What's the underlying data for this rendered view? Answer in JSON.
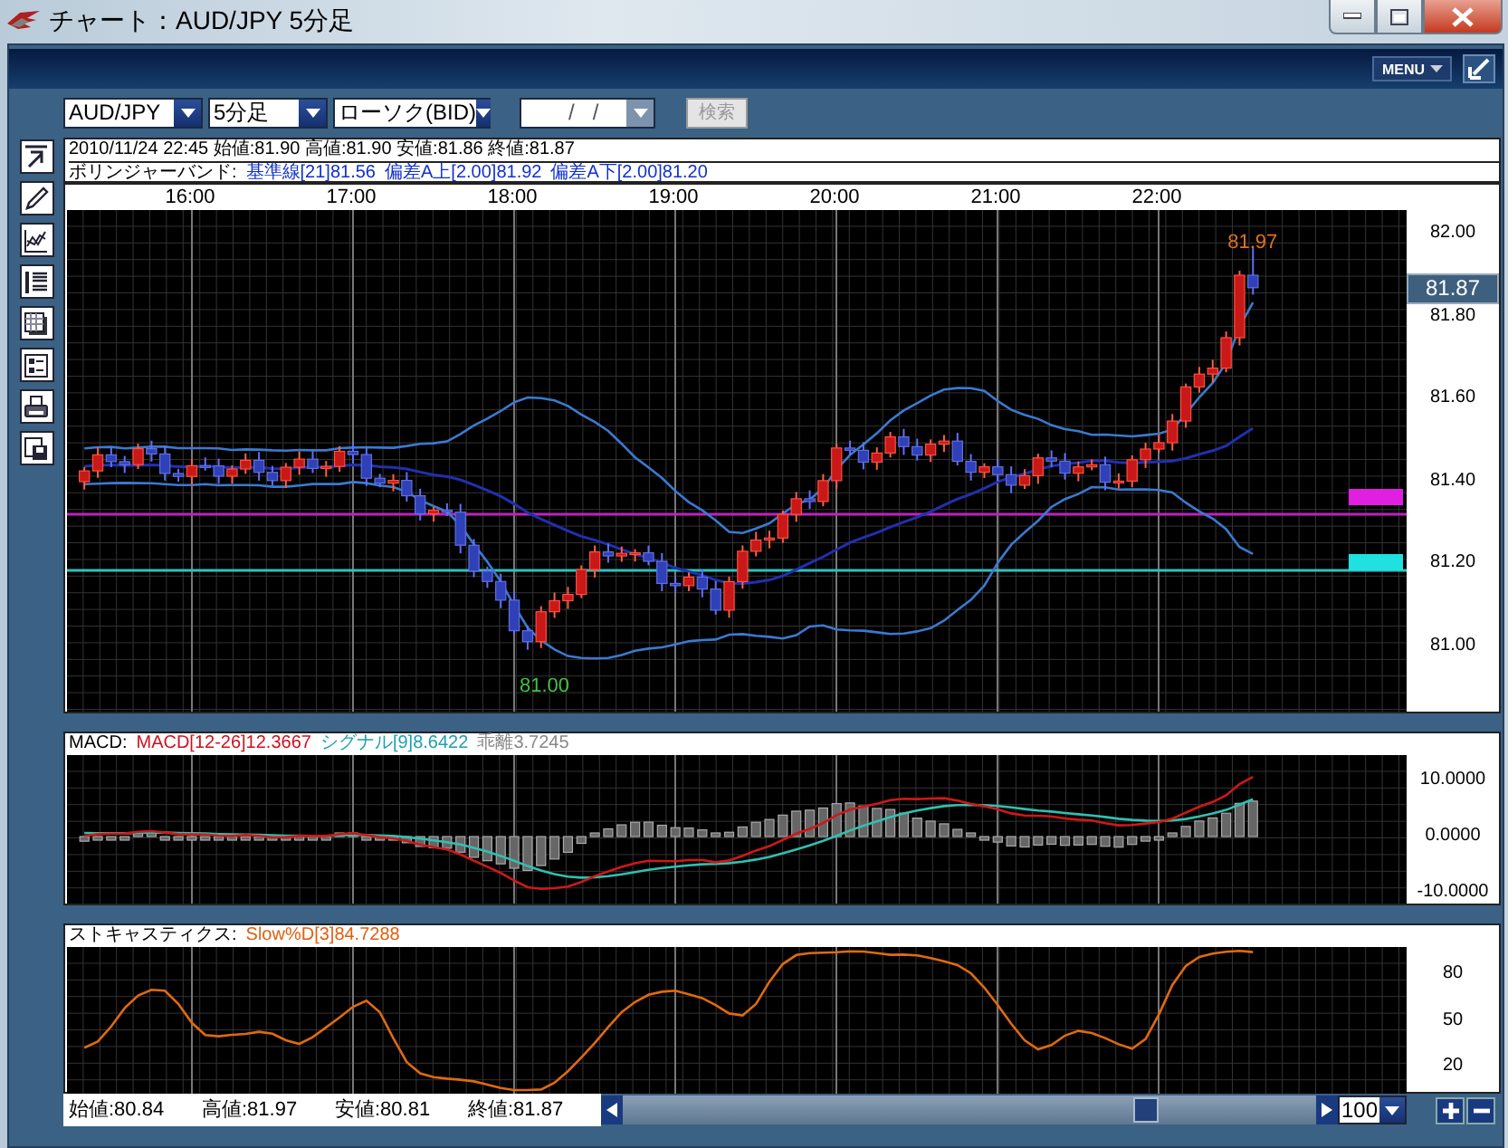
{
  "window": {
    "title": "チャート：AUD/JPY 5分足"
  },
  "header": {
    "menu_button": "MENU"
  },
  "toolbar": {
    "pair": "AUD/JPY",
    "timeframe": "5分足",
    "chart_type": "ローソク(BID)",
    "date_field": {
      "value": "/   /",
      "disabled": true
    },
    "search_button": {
      "label": "検索",
      "disabled": true
    }
  },
  "info": {
    "ohlc": "2010/11/24 22:45 始値:81.90 高値:81.90 安値:81.86 終値:81.87",
    "bollinger_label": "ボリンジャーバンド:",
    "bollinger_values": [
      "基準線[21]81.56",
      "偏差A上[2.00]81.92",
      "偏差A下[2.00]81.20"
    ]
  },
  "price_chart": {
    "time_labels": [
      "16:00",
      "17:00",
      "18:00",
      "19:00",
      "20:00",
      "21:00",
      "22:00"
    ],
    "price_labels": [
      "82.00",
      "81.80",
      "81.60",
      "81.40",
      "81.20",
      "81.00"
    ],
    "current_price": "81.87",
    "high_label": "81.97",
    "low_label": "81.00"
  },
  "macd": {
    "title": "MACD:",
    "macd": "MACD[12-26]12.3667",
    "signal": "シグナル[9]8.6422",
    "divergence": "乖離3.7245",
    "axis_labels": [
      "10.0000",
      "0.0000",
      "-10.0000"
    ]
  },
  "stochastic": {
    "title": "ストキャスティクス:",
    "slow_d": "Slow%D[3]84.7288",
    "axis_labels": [
      "80",
      "50",
      "20"
    ]
  },
  "status_bar": {
    "values": [
      "始値:80.84",
      "高値:81.97",
      "安値:80.81",
      "終値:81.87"
    ],
    "zoom": "100"
  }
}
